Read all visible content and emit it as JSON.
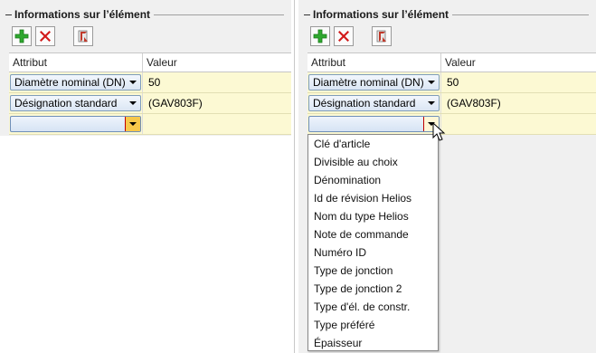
{
  "left_panel": {
    "group_title": "Informations sur l’élément",
    "columns": {
      "attribute": "Attribut",
      "value": "Valeur"
    },
    "rows": [
      {
        "attribute": "Diamètre nominal (DN)",
        "value": "50"
      },
      {
        "attribute": "Désignation standard",
        "value": "(GAV803F)"
      },
      {
        "attribute": "",
        "value": ""
      }
    ]
  },
  "right_panel": {
    "group_title": "Informations sur l’élément",
    "columns": {
      "attribute": "Attribut",
      "value": "Valeur"
    },
    "rows": [
      {
        "attribute": "Diamètre nominal (DN)",
        "value": "50"
      },
      {
        "attribute": "Désignation standard",
        "value": "(GAV803F)"
      },
      {
        "attribute": "",
        "value": ""
      }
    ],
    "dropdown_options": [
      "Clé d'article",
      "Divisible au choix",
      "Dénomination",
      "Id de révision Helios",
      "Nom du type Helios",
      "Note de commande",
      "Numéro ID",
      "Type de jonction",
      "Type de jonction 2",
      "Type d'él. de constr.",
      "Type préféré",
      "Épaisseur"
    ]
  },
  "toolbar_icons": [
    "add-icon",
    "delete-icon",
    "edit-icon"
  ],
  "colors": {
    "row_bg": "#fcf9d3",
    "add_green": "#2fa82f",
    "delete_red": "#d21a1a",
    "combo_arrow_highlight": "#f7c84a"
  }
}
